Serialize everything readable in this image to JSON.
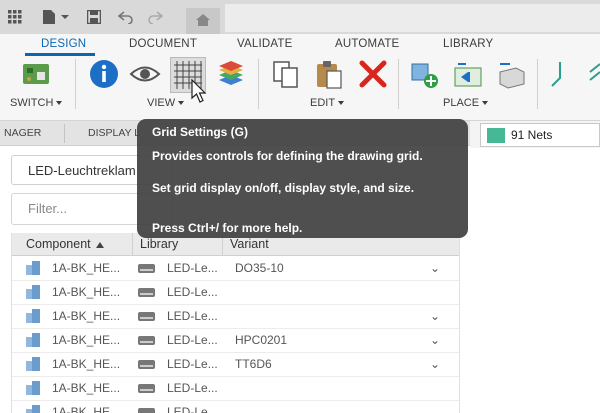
{
  "titlebar": {
    "icons": [
      "grid-apps-icon",
      "file-icon",
      "save-icon",
      "undo-icon",
      "redo-icon",
      "home-icon"
    ]
  },
  "ribbon": {
    "tabs": [
      "DESIGN",
      "DOCUMENT",
      "VALIDATE",
      "AUTOMATE",
      "LIBRARY"
    ],
    "active_tab": "DESIGN",
    "groups": {
      "switch": "SWITCH",
      "view": "VIEW",
      "edit": "EDIT",
      "place": "PLACE"
    },
    "colors": {
      "accent": "#0b66b2"
    }
  },
  "panel": {
    "tabs": [
      "NAGER",
      "DISPLAY L"
    ],
    "project_name": "LED-Leuchtreklam",
    "filter_placeholder": "Filter...",
    "columns": [
      "Component",
      "Library",
      "Variant"
    ],
    "rows": [
      {
        "component": "1A-BK_HE...",
        "library": "LED-Le...",
        "variant": "DO35-10",
        "has_dropdown": true
      },
      {
        "component": "1A-BK_HE...",
        "library": "LED-Le...",
        "variant": "",
        "has_dropdown": false
      },
      {
        "component": "1A-BK_HE...",
        "library": "LED-Le...",
        "variant": "",
        "has_dropdown": true
      },
      {
        "component": "1A-BK_HE...",
        "library": "LED-Le...",
        "variant": "HPC0201",
        "has_dropdown": true
      },
      {
        "component": "1A-BK_HE...",
        "library": "LED-Le...",
        "variant": "TT6D6",
        "has_dropdown": true
      },
      {
        "component": "1A-BK_HE...",
        "library": "LED-Le...",
        "variant": "",
        "has_dropdown": false
      },
      {
        "component": "1A-BK_HE...",
        "library": "LED-Le...",
        "variant": "",
        "has_dropdown": false
      }
    ]
  },
  "nets": {
    "label": "91 Nets",
    "color": "#46b895"
  },
  "tooltip": {
    "title": "Grid Settings (G)",
    "line1": "Provides controls for defining the drawing grid.",
    "line2": "Set grid display on/off, display style, and size.",
    "line3": "Press Ctrl+/ for more help."
  }
}
